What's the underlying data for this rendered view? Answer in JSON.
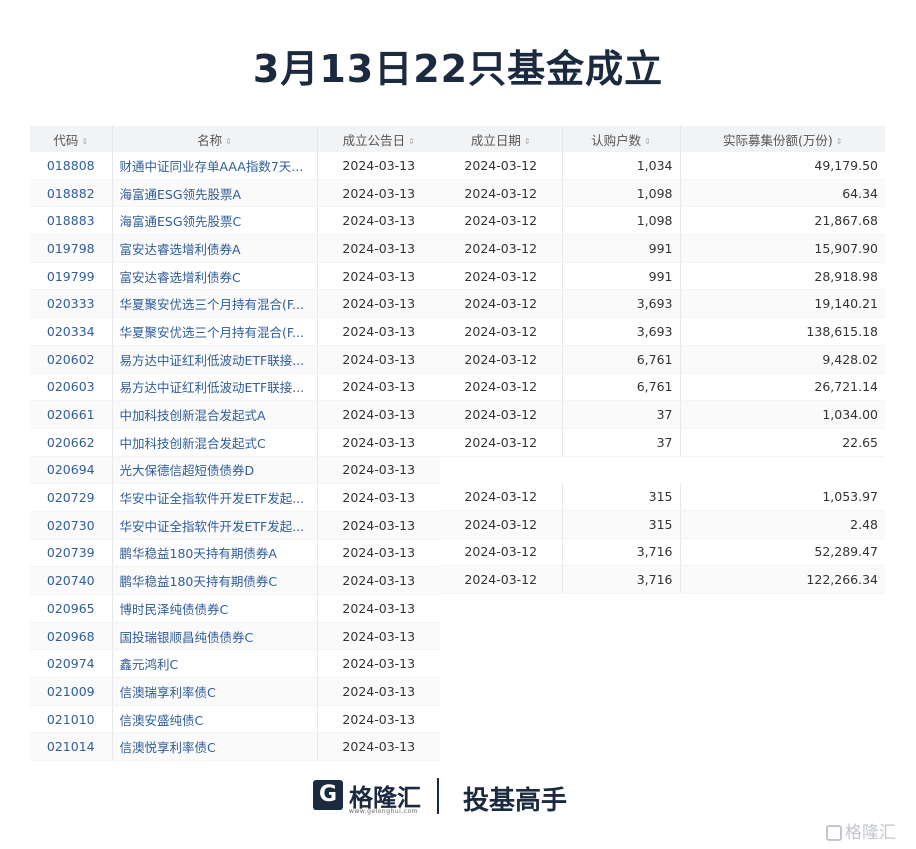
{
  "title": "3月13日22只基金成立",
  "left_columns": [
    "代码",
    "名称",
    "成立公告日"
  ],
  "right_columns": [
    "成立日期",
    "认购户数",
    "实际募集份额(万份)"
  ],
  "rows": [
    {
      "code": "018808",
      "name": "财通中证同业存单AAA指数7天...",
      "announce": "2024-03-13",
      "established": "2024-03-12",
      "subscribers": "1,034",
      "amount": "49,179.50"
    },
    {
      "code": "018882",
      "name": "海富通ESG领先股票A",
      "announce": "2024-03-13",
      "established": "2024-03-12",
      "subscribers": "1,098",
      "amount": "64.34"
    },
    {
      "code": "018883",
      "name": "海富通ESG领先股票C",
      "announce": "2024-03-13",
      "established": "2024-03-12",
      "subscribers": "1,098",
      "amount": "21,867.68"
    },
    {
      "code": "019798",
      "name": "富安达睿选增利债券A",
      "announce": "2024-03-13",
      "established": "2024-03-12",
      "subscribers": "991",
      "amount": "15,907.90"
    },
    {
      "code": "019799",
      "name": "富安达睿选增利债券C",
      "announce": "2024-03-13",
      "established": "2024-03-12",
      "subscribers": "991",
      "amount": "28,918.98"
    },
    {
      "code": "020333",
      "name": "华夏聚安优选三个月持有混合(F...",
      "announce": "2024-03-13",
      "established": "2024-03-12",
      "subscribers": "3,693",
      "amount": "19,140.21"
    },
    {
      "code": "020334",
      "name": "华夏聚安优选三个月持有混合(F...",
      "announce": "2024-03-13",
      "established": "2024-03-12",
      "subscribers": "3,693",
      "amount": "138,615.18"
    },
    {
      "code": "020602",
      "name": "易方达中证红利低波动ETF联接...",
      "announce": "2024-03-13",
      "established": "2024-03-12",
      "subscribers": "6,761",
      "amount": "9,428.02"
    },
    {
      "code": "020603",
      "name": "易方达中证红利低波动ETF联接...",
      "announce": "2024-03-13",
      "established": "2024-03-12",
      "subscribers": "6,761",
      "amount": "26,721.14"
    },
    {
      "code": "020661",
      "name": "中加科技创新混合发起式A",
      "announce": "2024-03-13",
      "established": "2024-03-12",
      "subscribers": "37",
      "amount": "1,034.00"
    },
    {
      "code": "020662",
      "name": "中加科技创新混合发起式C",
      "announce": "2024-03-13",
      "established": "2024-03-12",
      "subscribers": "37",
      "amount": "22.65"
    },
    {
      "code": "020694",
      "name": "光大保德信超短债债券D",
      "announce": "2024-03-13",
      "established": "",
      "subscribers": "",
      "amount": ""
    },
    {
      "code": "020729",
      "name": "华安中证全指软件开发ETF发起...",
      "announce": "2024-03-13",
      "established": "2024-03-12",
      "subscribers": "315",
      "amount": "1,053.97"
    },
    {
      "code": "020730",
      "name": "华安中证全指软件开发ETF发起...",
      "announce": "2024-03-13",
      "established": "2024-03-12",
      "subscribers": "315",
      "amount": "2.48"
    },
    {
      "code": "020739",
      "name": "鹏华稳益180天持有期债券A",
      "announce": "2024-03-13",
      "established": "2024-03-12",
      "subscribers": "3,716",
      "amount": "52,289.47"
    },
    {
      "code": "020740",
      "name": "鹏华稳益180天持有期债券C",
      "announce": "2024-03-13",
      "established": "2024-03-12",
      "subscribers": "3,716",
      "amount": "122,266.34"
    },
    {
      "code": "020965",
      "name": "博时民泽纯债债券C",
      "announce": "2024-03-13",
      "established": "",
      "subscribers": "",
      "amount": ""
    },
    {
      "code": "020968",
      "name": "国投瑞银顺昌纯债债券C",
      "announce": "2024-03-13",
      "established": "",
      "subscribers": "",
      "amount": ""
    },
    {
      "code": "020974",
      "name": "鑫元鸿利C",
      "announce": "2024-03-13",
      "established": "",
      "subscribers": "",
      "amount": ""
    },
    {
      "code": "021009",
      "name": "信澳瑞享利率债C",
      "announce": "2024-03-13",
      "established": "",
      "subscribers": "",
      "amount": ""
    },
    {
      "code": "021010",
      "name": "信澳安盛纯债C",
      "announce": "2024-03-13",
      "established": "",
      "subscribers": "",
      "amount": ""
    },
    {
      "code": "021014",
      "name": "信澳悦享利率债C",
      "announce": "2024-03-13",
      "established": "",
      "subscribers": "",
      "amount": ""
    }
  ],
  "footer": {
    "logo_mark": "G",
    "logo_name": "格隆汇",
    "logo_url": "www.gelonghui.com",
    "slogan": "投基高手"
  },
  "watermark": "格隆汇"
}
